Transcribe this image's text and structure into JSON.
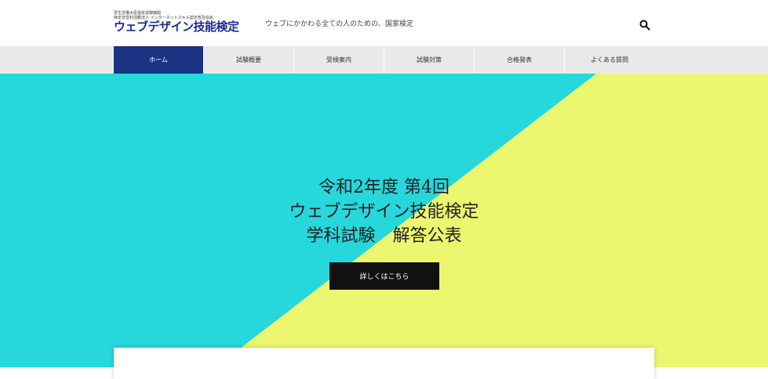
{
  "header": {
    "logo_line1": "厚生労働大臣指定試験機関",
    "logo_line2": "特定非営利活動法人 インターネットスキル認定普及協会",
    "logo_main": "ウェブデザイン技能検定",
    "tagline": "ウェブにかかわる全ての人のための、国家検定",
    "search_icon": "search-icon"
  },
  "nav": {
    "items": [
      {
        "label": "ホーム"
      },
      {
        "label": "試験概要"
      },
      {
        "label": "受検案内"
      },
      {
        "label": "試験対策"
      },
      {
        "label": "合格発表"
      },
      {
        "label": "よくある質問"
      }
    ],
    "active_color": "#1b3383"
  },
  "hero": {
    "title_line1": "令和2年度 第4回",
    "title_line2": "ウェブデザイン技能検定",
    "title_line3": "学科試験　解答公表",
    "button_label": "詳しくはこちら",
    "colors": {
      "cyan": "#26d7dc",
      "yellow": "#ecf66e"
    }
  }
}
